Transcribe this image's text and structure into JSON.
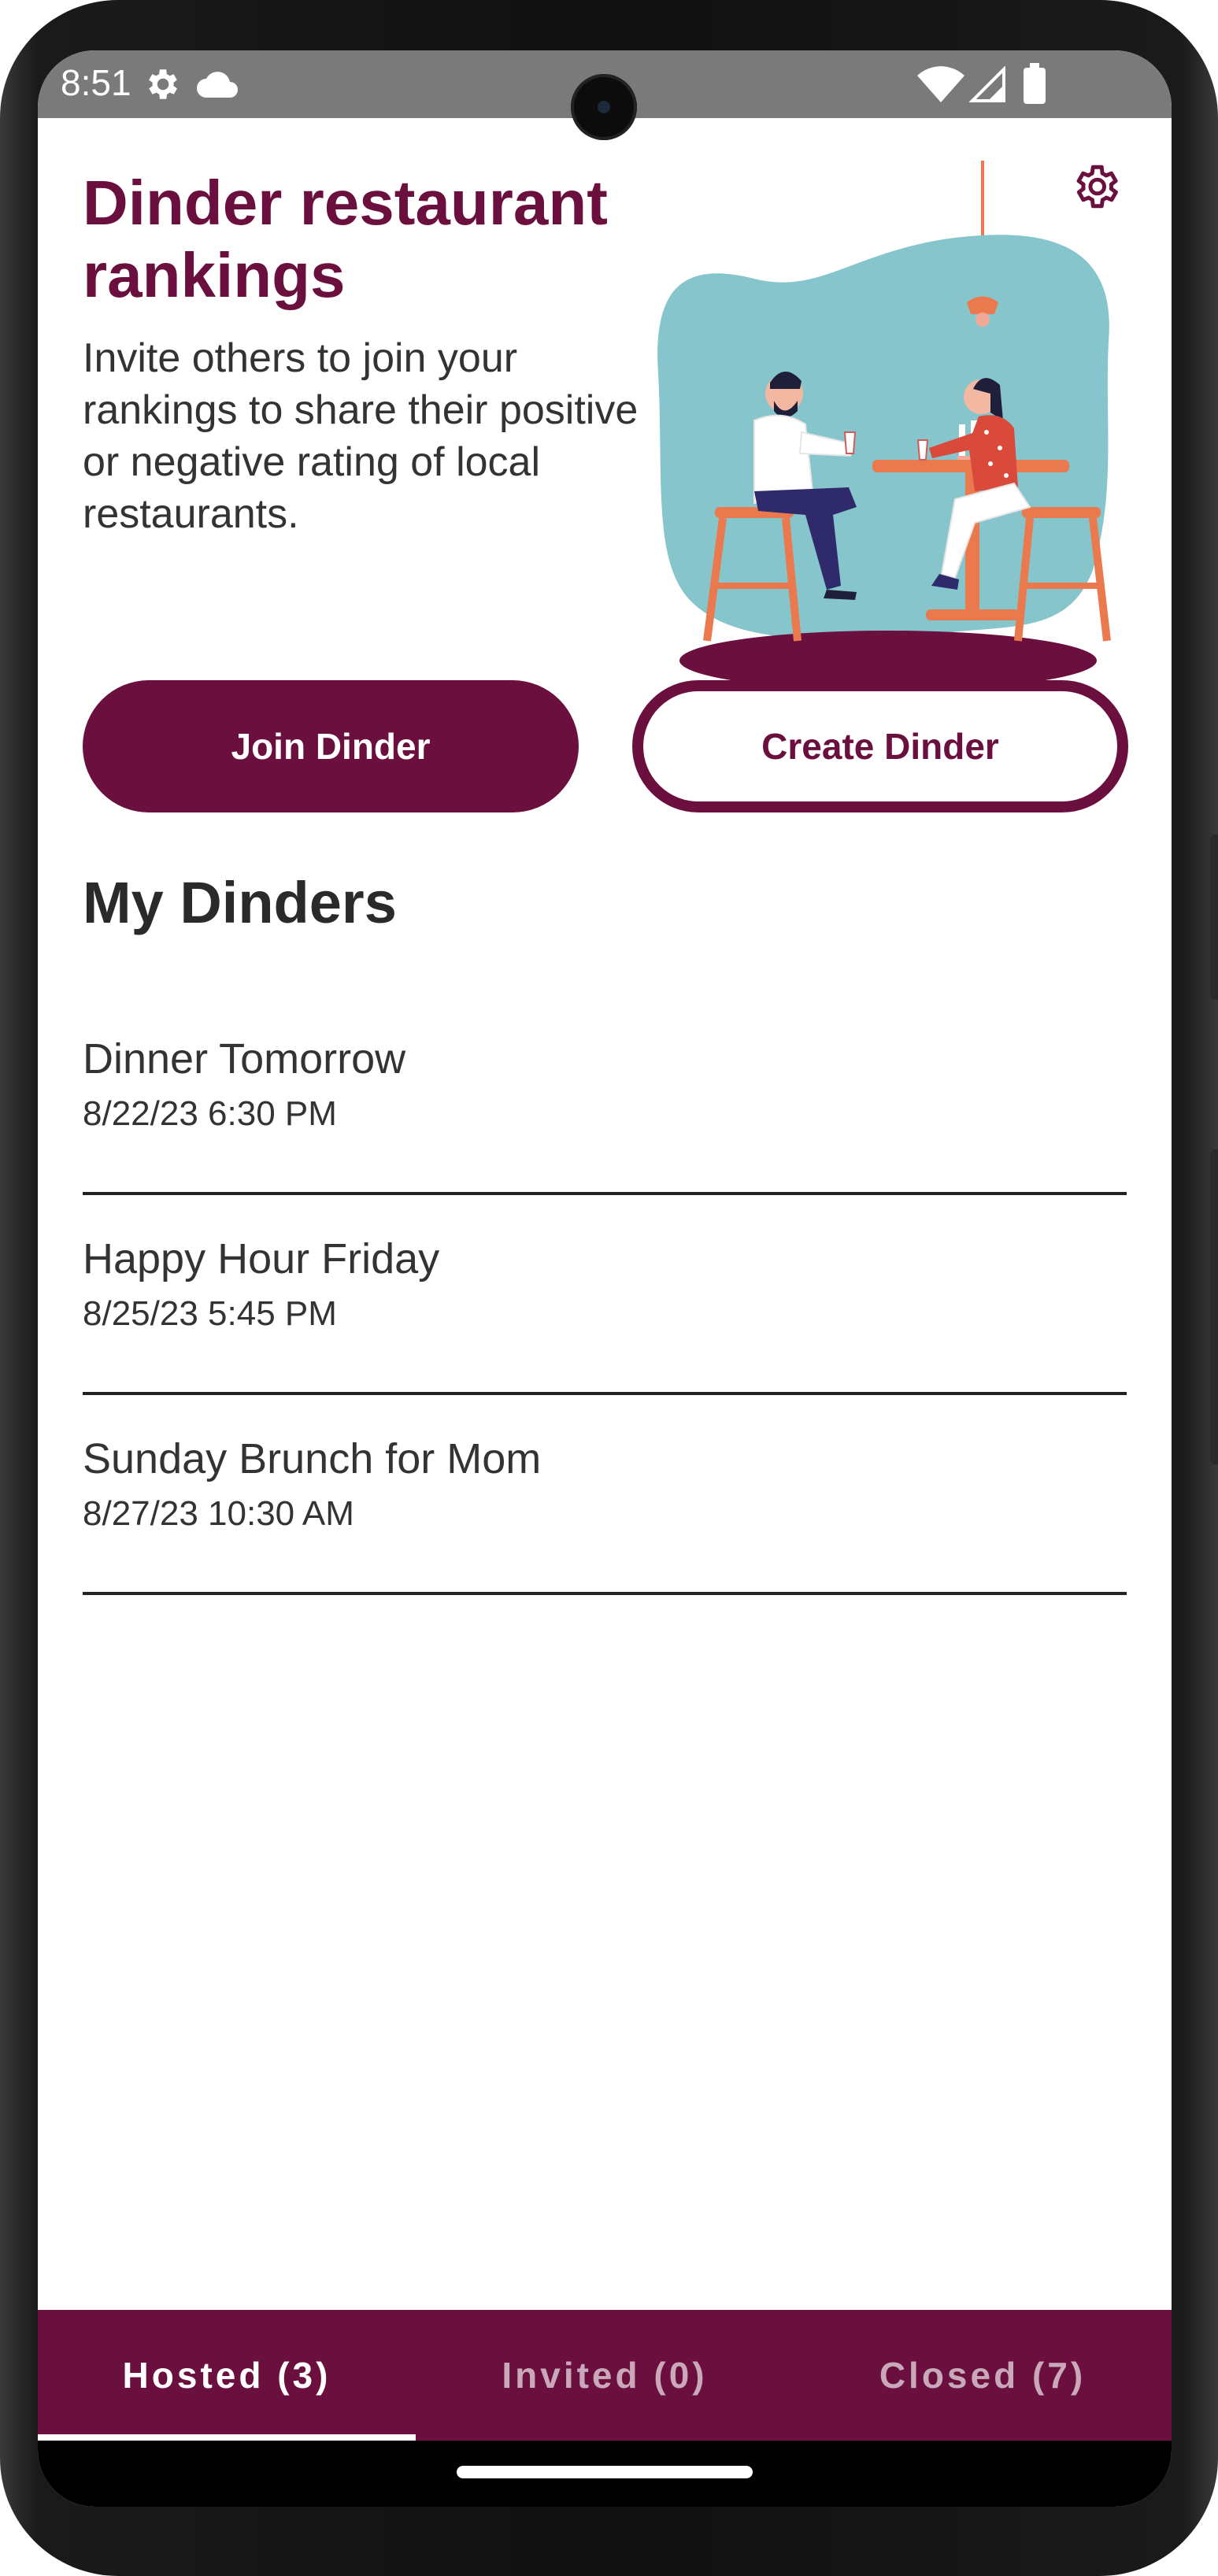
{
  "status_bar": {
    "time": "8:51",
    "left_icons": [
      "gear-icon",
      "cloud-icon"
    ],
    "right_icons": [
      "wifi-icon",
      "cell-signal-icon",
      "battery-icon"
    ]
  },
  "header": {
    "title": "Dinder restaurant rankings",
    "subtitle": "Invite others to join your rankings to share their positive or negative rating of local restaurants.",
    "settings_icon": "gear-icon"
  },
  "actions": {
    "join_label": "Join Dinder",
    "create_label": "Create Dinder"
  },
  "my_dinders": {
    "title": "My Dinders",
    "items": [
      {
        "name": "Dinner Tomorrow",
        "date": "8/22/23 6:30 PM"
      },
      {
        "name": "Happy Hour Friday",
        "date": "8/25/23 5:45 PM"
      },
      {
        "name": "Sunday Brunch for Mom",
        "date": "8/27/23 10:30 AM"
      }
    ]
  },
  "tabs": [
    {
      "label": "Hosted (3)",
      "active": true
    },
    {
      "label": "Invited (0)",
      "active": false
    },
    {
      "label": "Closed (7)",
      "active": false
    }
  ],
  "colors": {
    "brand": "#6b0f3f",
    "text": "#333333",
    "status_bar": "#7a7a7a",
    "illustration_bg": "#86c5cc",
    "furniture": "#ea7a4e"
  }
}
